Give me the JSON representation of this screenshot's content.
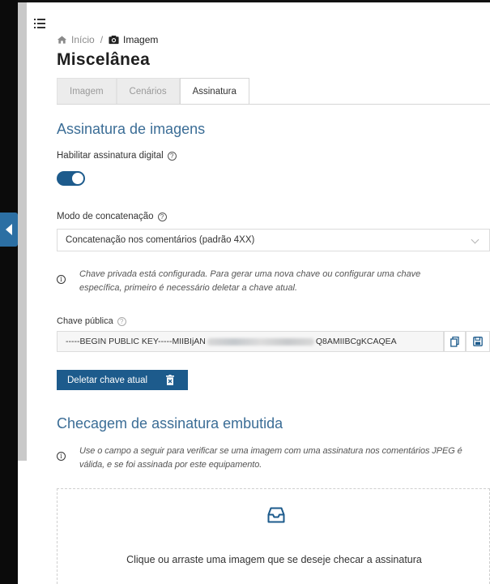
{
  "breadcrumb": {
    "home_label": "Início",
    "separator": "/",
    "current_label": "Imagem",
    "home_icon": "home-icon",
    "current_icon": "camera-icon"
  },
  "page_title": "Miscelânea",
  "tabs": [
    {
      "label": "Imagem",
      "active": false
    },
    {
      "label": "Cenários",
      "active": false
    },
    {
      "label": "Assinatura",
      "active": true
    }
  ],
  "signature_section": {
    "title": "Assinatura de imagens",
    "enable_label": "Habilitar assinatura digital",
    "enable_value": true,
    "concat_label": "Modo de concatenação",
    "concat_selected": "Concatenação nos comentários (padrão 4XX)",
    "private_key_info": "Chave privada está configurada. Para gerar uma nova chave ou configurar uma chave específica, primeiro é necessário deletar a chave atual.",
    "public_key_label": "Chave pública",
    "public_key_start": "-----BEGIN PUBLIC KEY-----MIIBIjAN",
    "public_key_end": "Q8AMIIBCgKCAQEA",
    "delete_button": "Deletar chave atual"
  },
  "check_section": {
    "title": "Checagem de assinatura embutida",
    "info": "Use o campo a seguir para verificar se uma imagem com uma assinatura nos comentários JPEG é válida, e se foi assinada por este equipamento.",
    "dropzone_text": "Clique ou arraste uma imagem que se deseje checar a assinatura",
    "dropzone_icon": "inbox-icon"
  },
  "colors": {
    "accent": "#1d5b8c",
    "section_title": "#3b6d96",
    "sidebar_tab": "#2c6fa3"
  }
}
